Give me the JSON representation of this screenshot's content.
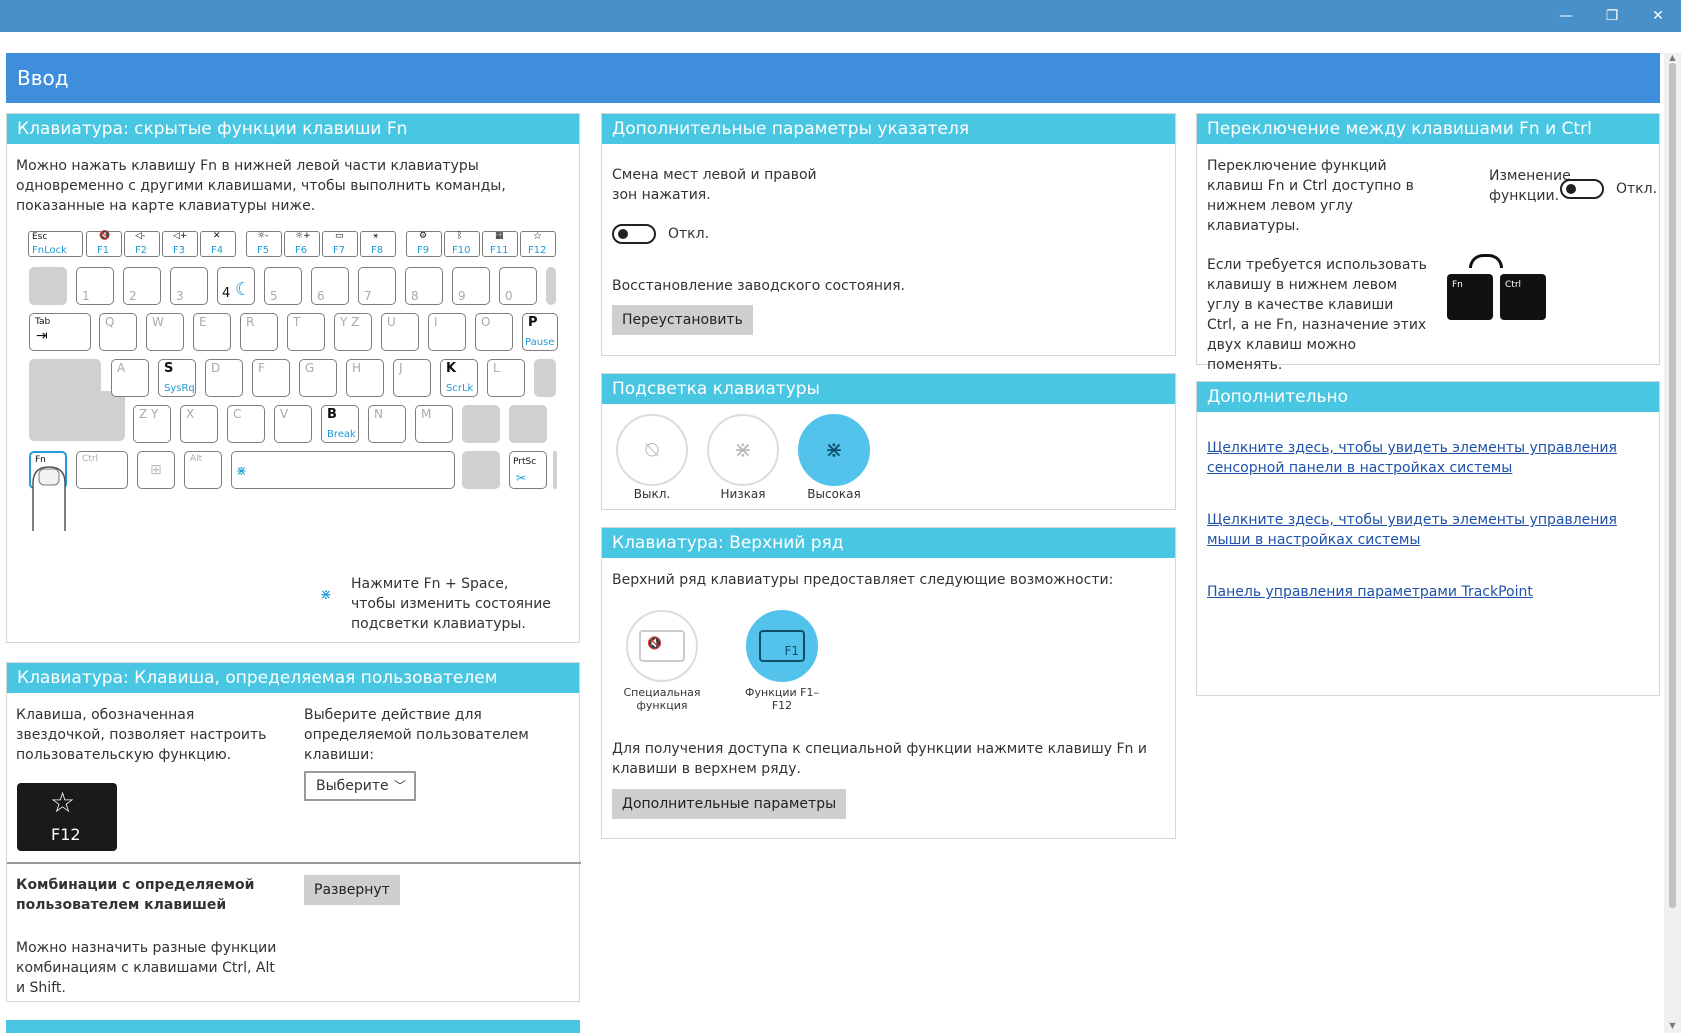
{
  "window": {
    "minimize": "—",
    "restore": "❐",
    "close": "✕"
  },
  "page": {
    "title": "Ввод"
  },
  "fn_keys_card": {
    "title": "Клавиатура: скрытые функции клавиши Fn",
    "description": "Можно нажать клавишу Fn в нижней левой части клавиатуры одновременно с другими клавишами, чтобы выполнить команды, показанные на карте клавиатуры ниже.",
    "hint": "Нажмите Fn + Space, чтобы изменить состояние подсветки клавиатуры.",
    "keyboard": {
      "fn_row": [
        {
          "top": "Esc",
          "bottom": "FnLock"
        },
        {
          "top": "🔇",
          "bottom": "F1"
        },
        {
          "top": "◁-",
          "bottom": "F2"
        },
        {
          "top": "◁+",
          "bottom": "F3"
        },
        {
          "top": "✕",
          "bottom": "F4"
        },
        {
          "top": "☼-",
          "bottom": "F5"
        },
        {
          "top": "☼+",
          "bottom": "F6"
        },
        {
          "top": "▭",
          "bottom": "F7"
        },
        {
          "top": "⚹",
          "bottom": "F8"
        },
        {
          "top": "⚙",
          "bottom": "F9"
        },
        {
          "top": "ᛒ",
          "bottom": "F10"
        },
        {
          "top": "▦",
          "bottom": "F11"
        },
        {
          "top": "☆",
          "bottom": "F12"
        }
      ],
      "num_row": [
        "1",
        "2",
        "3",
        "4",
        "5",
        "6",
        "7",
        "8",
        "9",
        "0"
      ],
      "row_q": [
        "Q",
        "W",
        "E",
        "R",
        "T",
        "Y Z",
        "U",
        "I",
        "O"
      ],
      "row_a": [
        "A",
        "S",
        "D",
        "F",
        "G",
        "H",
        "J",
        "K",
        "L"
      ],
      "row_z": [
        "Z Y",
        "X",
        "C",
        "V",
        "B",
        "N",
        "M"
      ],
      "tab": "Tab",
      "p_main": "P",
      "p_fn": "Pause",
      "s_fn": "SysRq",
      "k_fn": "ScrLk",
      "b_fn": "Break",
      "fn": "Fn",
      "ctrl": "Ctrl",
      "alt": "Alt",
      "prtsc": "PrtSc"
    }
  },
  "user_key_card": {
    "title": "Клавиатура: Клавиша, определяемая пользователем",
    "description": "Клавиша, обозначенная звездочкой, позволяет настроить пользовательскую функцию.",
    "select_label": "Выберите действие для определяемой пользователем клавиши:",
    "select_value": "Выберите",
    "key_label": "F12",
    "combo_title": "Комбинации с определяемой пользователем клавишей",
    "combo_button": "Развернут",
    "combo_description": "Можно назначить разные функции комбинациям с клавишами Ctrl, Alt и Shift."
  },
  "pointer_card": {
    "title": "Дополнительные параметры указателя",
    "swap_label": "Смена мест левой и правой зон нажатия.",
    "swap_state": "Откл.",
    "reset_label": "Восстановление заводского состояния.",
    "reset_button": "Переустановить"
  },
  "backlight_card": {
    "title": "Подсветка клавиатуры",
    "options": [
      "Выкл.",
      "Низкая",
      "Высокая"
    ],
    "selected": "Высокая"
  },
  "top_row_card": {
    "title": "Клавиатура: Верхний ряд",
    "description": "Верхний ряд клавиатуры предоставляет следующие возможности:",
    "options": [
      "Специальная функция",
      "Функции F1–F12"
    ],
    "selected": "Функции F1–F12",
    "f1_label": "F1",
    "note": "Для получения доступа к специальной функции нажмите клавишу Fn и клавиши в верхнем ряду.",
    "button": "Дополнительные параметры"
  },
  "swap_card": {
    "title": "Переключение между клавишами Fn и Ctrl",
    "description": "Переключение функций клавиш Fn и Ctrl доступно в нижнем левом углу клавиатуры.",
    "change_label": "Изменение функции.",
    "state": "Откл.",
    "note": "Если требуется использовать клавишу в нижнем левом углу в качестве клавиши Ctrl, а не Fn, назначение этих двух клавиш можно поменять.",
    "key_fn": "Fn",
    "key_ctrl": "Ctrl"
  },
  "more_card": {
    "title": "Дополнительно",
    "links": [
      "Щелкните здесь, чтобы увидеть элементы управления сенсорной панели в настройках системы",
      "Щелкните здесь, чтобы увидеть элементы управления мыши в настройках системы",
      "Панель управления параметрами TrackPoint"
    ]
  },
  "colors": {
    "accent": "#49c6e2",
    "header": "#3f8edc",
    "titlebar": "#4a90c8",
    "selected": "#53c3ec",
    "link": "#1f52a8"
  }
}
